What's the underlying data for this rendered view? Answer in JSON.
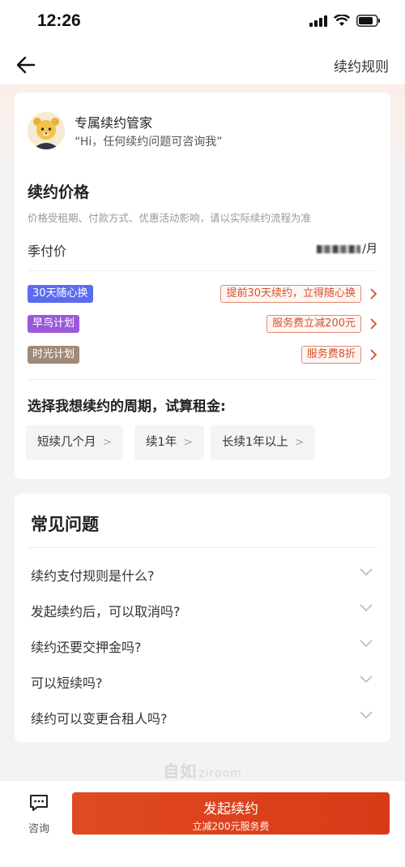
{
  "status_bar": {
    "time": "12:26"
  },
  "nav": {
    "right_link": "续约规则"
  },
  "advisor": {
    "name": "专属续约管家",
    "message": "“Hi，任何续约问题可咨询我”"
  },
  "pricing": {
    "title": "续约价格",
    "note": "价格受租期、付款方式、优惠活动影响，请以实际续约流程为准",
    "row_label": "季付价",
    "row_value_suffix": "/月"
  },
  "promos": [
    {
      "tag": "30天随心换",
      "tag_color": "#5b6cf0",
      "desc": "提前30天续约，立得随心换"
    },
    {
      "tag": "早鸟计划",
      "tag_color": "#9b58d8",
      "desc": "服务费立减200元"
    },
    {
      "tag": "时光计划",
      "tag_color": "#a08a78",
      "desc": "服务费8折"
    }
  ],
  "calc": {
    "title": "选择我想续约的周期，试算租金:",
    "options": [
      "短续几个月",
      "续1年",
      "长续1年以上"
    ]
  },
  "faq": {
    "title": "常见问题",
    "items": [
      "续约支付规则是什么?",
      "发起续约后，可以取消吗?",
      "续约还要交押金吗?",
      "可以短续吗?",
      "续约可以变更合租人吗?"
    ]
  },
  "watermark": {
    "cn": "自如",
    "en": "ziroom"
  },
  "bottom": {
    "consult_label": "咨询",
    "cta_main": "发起续约",
    "cta_sub": "立减200元服务费",
    "accent": "#e04a22"
  }
}
